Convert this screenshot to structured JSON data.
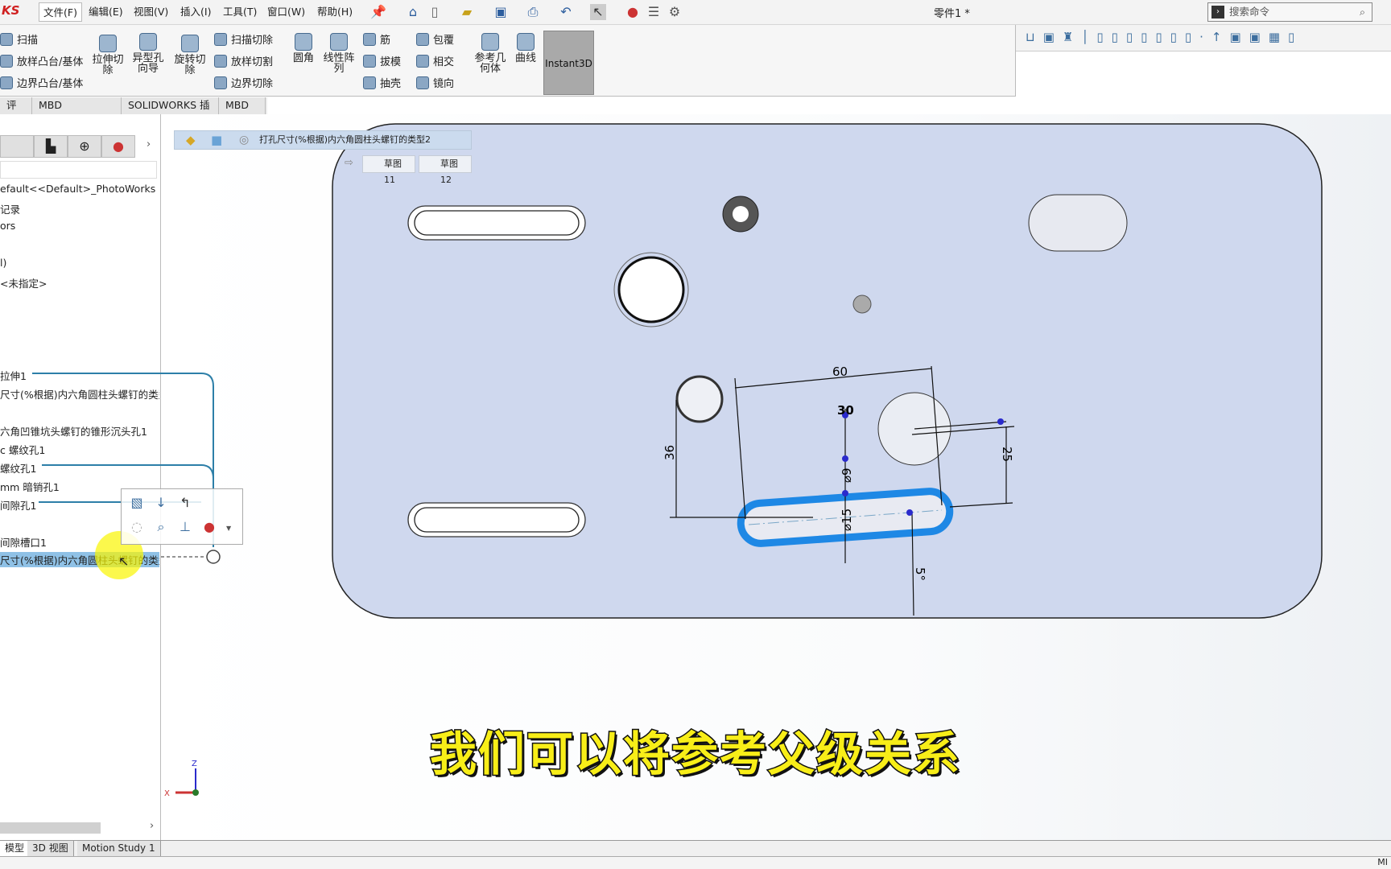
{
  "app": {
    "logo": "KS",
    "doc_title": "零件1 *"
  },
  "menu": [
    "文件(F)",
    "编辑(E)",
    "视图(V)",
    "插入(I)",
    "工具(T)",
    "窗口(W)",
    "帮助(H)"
  ],
  "search": {
    "placeholder": "搜索命令"
  },
  "ribbon": {
    "col1": [
      "扫描",
      "放样凸台/基体",
      "边界凸台/基体"
    ],
    "big1": [
      "拉伸切除",
      "异型孔向导",
      "旋转切除"
    ],
    "col2": [
      "扫描切除",
      "放样切割",
      "边界切除"
    ],
    "big2": [
      "圆角",
      "线性阵列"
    ],
    "col3": [
      "筋",
      "拔模",
      "抽壳"
    ],
    "col4": [
      "包覆",
      "相交",
      "镜向"
    ],
    "big3": [
      "参考几何体",
      "曲线"
    ],
    "instant3d": "Instant3D"
  },
  "tabs": [
    "评估",
    "MBD Dimensions",
    "SOLIDWORKS 插件",
    "MBD"
  ],
  "tree": {
    "items": [
      "efault<<Default>_PhotoWorks Di",
      "记录",
      "ors",
      "l)",
      "<未指定>",
      "拉伸1",
      "尺寸(%根据)内六角圆柱头螺钉的类型",
      "六角凹锥坑头螺钉的锥形沉头孔1",
      "c 螺纹孔1",
      "螺纹孔1",
      "mm 暗销孔1",
      "间隙孔1",
      "间隙槽口1",
      "尺寸(%根据)内六角圆柱头螺钉的类型"
    ],
    "selected_index": 13
  },
  "breadcrumb": {
    "feature": "打孔尺寸(%根据)内六角圆柱头螺钉的类型2",
    "sketches": [
      "草图11",
      "草图12"
    ]
  },
  "dimensions": {
    "d60": "60",
    "d30": "30",
    "d36": "36",
    "d25": "25",
    "phi9": "⌀9",
    "phi15": "⌀15",
    "angle": "5°"
  },
  "triad": {
    "z": "Z",
    "x": "X"
  },
  "bottom_tabs": [
    "模型",
    "3D 视图",
    "Motion Study 1"
  ],
  "status": {
    "right": "MI"
  },
  "subtitle": "我们可以将参考父级关系",
  "colors": {
    "part_face": "#cfd8ee",
    "selection": "#1e88e5",
    "accent": "#2d6fa8",
    "subtitle": "#f8ee18"
  }
}
